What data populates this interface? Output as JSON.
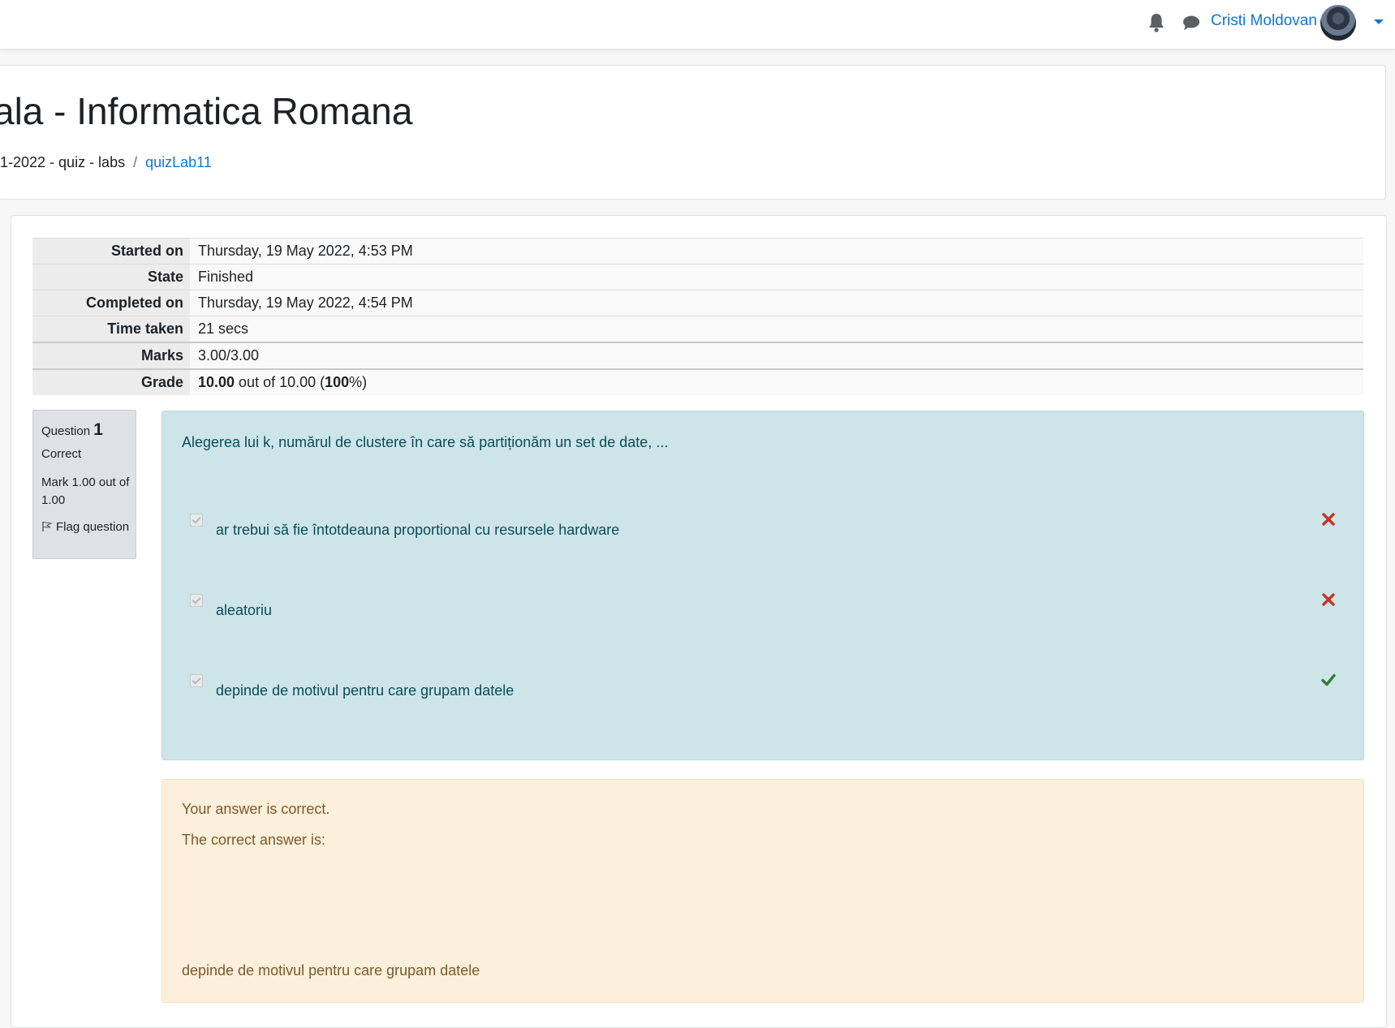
{
  "navbar": {
    "notification_icon": "bell-icon",
    "messages_icon": "chat-bubble-icon",
    "user_name": "Cristi Moldovan"
  },
  "header": {
    "title": "ala - Informatica Romana",
    "breadcrumb": {
      "parent": "1-2022 - quiz - labs",
      "separator": "/",
      "current": "quizLab11"
    }
  },
  "summary": {
    "started_on_label": "Started on",
    "started_on": "Thursday, 19 May 2022, 4:53 PM",
    "state_label": "State",
    "state": "Finished",
    "completed_on_label": "Completed on",
    "completed_on": "Thursday, 19 May 2022, 4:54 PM",
    "time_taken_label": "Time taken",
    "time_taken": "21 secs",
    "marks_label": "Marks",
    "marks": "3.00/3.00",
    "grade_label": "Grade",
    "grade_value": "10.00",
    "grade_rest": " out of 10.00 (",
    "grade_percent": "100",
    "grade_end": "%)"
  },
  "question": {
    "label": "Question",
    "number": "1",
    "state": "Correct",
    "grade": "Mark 1.00 out of 1.00",
    "flag": "Flag question",
    "text": "Alegerea lui k, numărul de clustere în care să partiționăm un set de date, ...",
    "answers": [
      {
        "text": "ar trebui să fie întotdeauna proportional cu resursele hardware",
        "checked": true,
        "result": "incorrect",
        "color": "#ca3120"
      },
      {
        "text": "aleatoriu",
        "checked": true,
        "result": "incorrect",
        "color": "#ca3120"
      },
      {
        "text": "depinde de motivul pentru care grupam datele",
        "checked": true,
        "result": "correct",
        "color": "#357a32"
      }
    ]
  },
  "outcome": {
    "feedback": "Your answer is correct.",
    "correct_answer_label": "The correct answer is:",
    "correct_answer": "depinde de motivul pentru care grupam datele"
  },
  "colors": {
    "link": "#1177d1",
    "formulation_bg": "#cde5e9",
    "outcome_bg": "#fcefdc",
    "correct": "#357a32",
    "incorrect": "#ca3120"
  }
}
